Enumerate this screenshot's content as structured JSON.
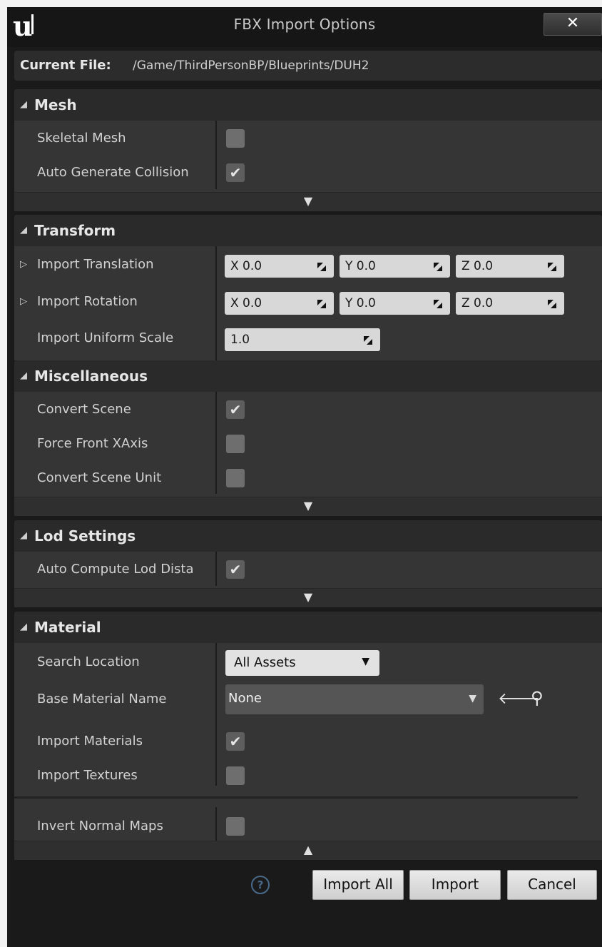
{
  "window": {
    "title": "FBX Import Options",
    "close_label": "✕",
    "logo": "unreal-logo"
  },
  "current_file": {
    "label": "Current File:",
    "path": "/Game/ThirdPersonBP/Blueprints/DUH2"
  },
  "sections": {
    "mesh": {
      "title": "Mesh",
      "skeletal_mesh": {
        "label": "Skeletal Mesh",
        "checked": false
      },
      "auto_generate_collision": {
        "label": "Auto Generate Collision",
        "checked": true
      }
    },
    "transform": {
      "title": "Transform",
      "import_translation": {
        "label": "Import Translation",
        "x": "X  0.0",
        "y": "Y  0.0",
        "z": "Z  0.0"
      },
      "import_rotation": {
        "label": "Import Rotation",
        "x": "X  0.0",
        "y": "Y  0.0",
        "z": "Z  0.0"
      },
      "import_uniform_scale": {
        "label": "Import Uniform Scale",
        "value": "1.0"
      }
    },
    "misc": {
      "title": "Miscellaneous",
      "convert_scene": {
        "label": "Convert Scene",
        "checked": true
      },
      "force_front_xaxis": {
        "label": "Force Front XAxis",
        "checked": false
      },
      "convert_scene_unit": {
        "label": "Convert Scene Unit",
        "checked": false
      }
    },
    "lod": {
      "title": "Lod Settings",
      "auto_compute_lod_distances": {
        "label": "Auto Compute Lod Dista",
        "checked": true
      }
    },
    "material": {
      "title": "Material",
      "search_location": {
        "label": "Search Location",
        "value": "All Assets"
      },
      "base_material_name": {
        "label": "Base Material Name",
        "value": "None"
      },
      "import_materials": {
        "label": "Import Materials",
        "checked": true
      },
      "import_textures": {
        "label": "Import Textures",
        "checked": false
      },
      "invert_normal_maps": {
        "label": "Invert Normal Maps",
        "checked": false
      }
    }
  },
  "icons": {
    "expand": "▼",
    "collapse": "▲",
    "section_tri": "◢",
    "expander_tri": "▷",
    "check": "✔",
    "back_arrow": "🡐",
    "search": "⚲",
    "help": "?"
  },
  "footer": {
    "import_all": "Import All",
    "import": "Import",
    "cancel": "Cancel"
  }
}
